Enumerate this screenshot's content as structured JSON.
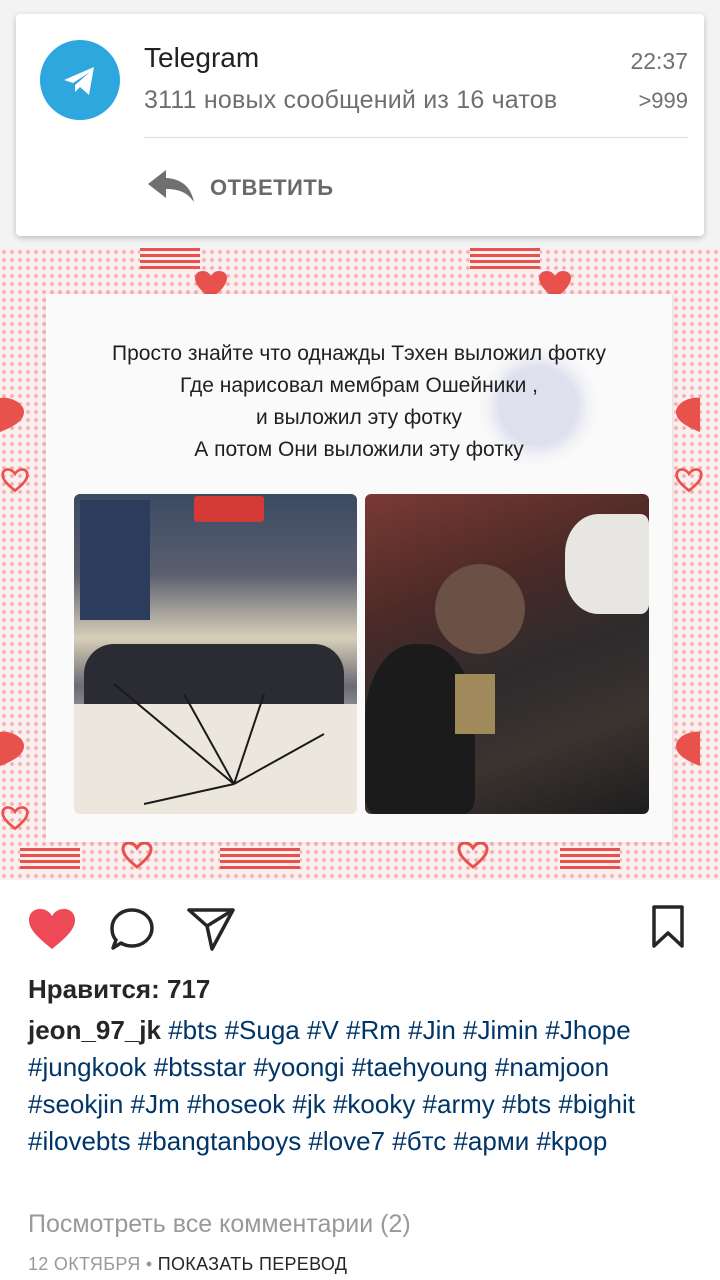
{
  "notification": {
    "app_name": "Telegram",
    "time": "22:37",
    "message": "3111 новых сообщений из 16 чатов",
    "count": ">999",
    "reply_label": "ОТВЕТИТЬ",
    "icon": "telegram-icon",
    "accent_color": "#2ea6de"
  },
  "post": {
    "image_text": {
      "lines": [
        "Просто знайте что однажды Тэхен выложил фотку",
        "Где нарисовал мембрам Ошейники ,",
        "и выложил эту фотку",
        "А потом Они выложили эту фотку"
      ]
    },
    "likes": "Нравится: 717",
    "username": "jeon_97_jk",
    "hashtags": "#bts #Suga #V #Rm #Jin #Jimin #Jhope #jungkook #btsstar #yoongi #taehyoung #namjoon #seokjin #Jm #hoseok #jk #kooky #army #bts #bighit #ilovebts #bangtanboys #love7 #бтс #арми #kpop",
    "view_comments": "Посмотреть все комментарии (2)",
    "date": "12 ОКТЯБРЯ",
    "separator": " • ",
    "show_translation": "ПОКАЗАТЬ ПЕРЕВОД"
  },
  "actions": {
    "like_icon": "heart-filled-icon",
    "comment_icon": "comment-icon",
    "share_icon": "direct-share-icon",
    "save_icon": "bookmark-icon",
    "like_color": "#ed4956"
  }
}
